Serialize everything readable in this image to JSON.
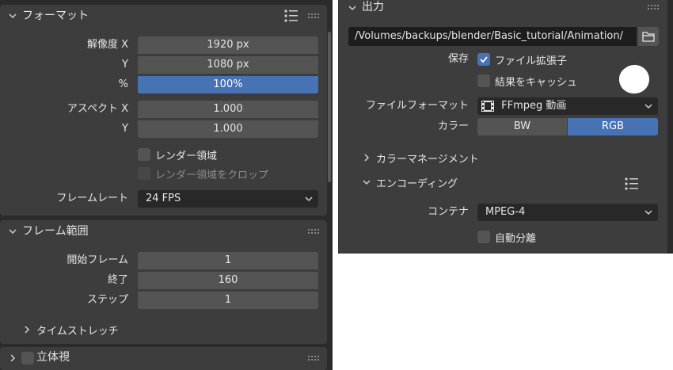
{
  "colors": {
    "panel_bg": "#3d3d3d",
    "field_bg": "#545454",
    "accent_blue": "#4772b3",
    "text": "#e6e6e6",
    "dropdown_bg": "#282828"
  },
  "left": {
    "format": {
      "title": "フォーマット",
      "resolution_x_label": "解像度 X",
      "resolution_x": "1920 px",
      "resolution_y_label": "Y",
      "resolution_y": "1080 px",
      "percent_label": "%",
      "percent": "100%",
      "aspect_x_label": "アスペクト X",
      "aspect_x": "1.000",
      "aspect_y_label": "Y",
      "aspect_y": "1.000",
      "render_region": "レンダー領域",
      "crop_region": "レンダー領域をクロップ",
      "frame_rate_label": "フレームレート",
      "frame_rate": "24 FPS"
    },
    "frame_range": {
      "title": "フレーム範囲",
      "start_label": "開始フレーム",
      "start": "1",
      "end_label": "終了",
      "end": "160",
      "step_label": "ステップ",
      "step": "1",
      "time_stretch": "タイムストレッチ"
    },
    "stereo": {
      "title": "立体視"
    }
  },
  "right": {
    "output": {
      "title": "出力",
      "path": "/Volumes/backups/blender/Basic_tutorial/Animation/",
      "save_label": "保存",
      "file_extensions": "ファイル拡張子",
      "cache_result": "結果をキャッシュ",
      "file_format_label": "ファイルフォーマット",
      "file_format": "FFmpeg 動画",
      "color_label": "カラー",
      "color_options": [
        "BW",
        "RGB"
      ],
      "color_selected": "RGB",
      "color_management": "カラーマネージメント",
      "encoding": "エンコーディング",
      "container_label": "コンテナ",
      "container": "MPEG-4",
      "autosplit": "自動分離"
    }
  }
}
